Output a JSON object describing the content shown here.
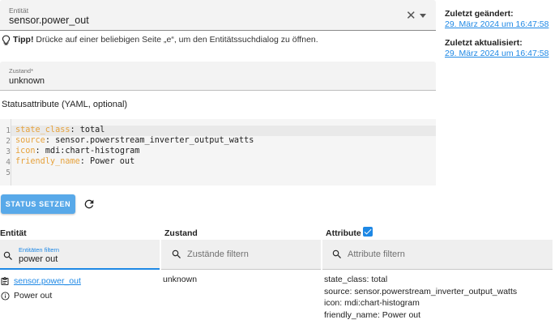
{
  "entity_field": {
    "label": "Entität",
    "value": "sensor.power_out",
    "clear_icon": "close-icon",
    "dropdown_icon": "arrow-drop-down-icon"
  },
  "tip": {
    "icon": "lightbulb-icon",
    "bold": "Tipp!",
    "text": "Drücke auf einer beliebigen Seite „e“, um den Entitätssuchdialog zu öffnen."
  },
  "sidebar": {
    "changed_label": "Zuletzt geändert:",
    "changed_value": "29. März 2024 um 16:47:58",
    "updated_label": "Zuletzt aktualisiert:",
    "updated_value": "29. März 2024 um 16:47:58"
  },
  "state_field": {
    "label": "Zustand*",
    "value": "unknown"
  },
  "attributes_label": "Statusattribute (YAML, optional)",
  "editor": {
    "lines": [
      {
        "num": "1",
        "key": "state_class",
        "value": ": total"
      },
      {
        "num": "2",
        "key": "source",
        "value": ": sensor.powerstream_inverter_output_watts"
      },
      {
        "num": "3",
        "key": "icon",
        "value": ": mdi:chart-histogram"
      },
      {
        "num": "4",
        "key": "friendly_name",
        "value": ": Power out"
      },
      {
        "num": "5",
        "key": "",
        "value": ""
      }
    ]
  },
  "actions": {
    "set_state_label": "STATUS SETZEN",
    "refresh_icon": "refresh-icon"
  },
  "table": {
    "headers": {
      "entity": "Entität",
      "state": "Zustand",
      "attributes": "Attribute"
    },
    "filters": {
      "entity_label": "Entitäten filtern",
      "entity_value": "power out",
      "state_placeholder": "Zustände filtern",
      "attributes_placeholder": "Attribute filtern"
    },
    "row": {
      "entity_id": "sensor.power_out",
      "friendly_name": "Power out",
      "state": "unknown",
      "attributes": [
        "state_class: total",
        "source: sensor.powerstream_inverter_output_watts",
        "icon: mdi:chart-histogram",
        "friendly_name: Power out"
      ]
    }
  },
  "colors": {
    "accent": "#1e88e5",
    "button": "#58a9e9",
    "yaml_key": "#e6a23c"
  }
}
